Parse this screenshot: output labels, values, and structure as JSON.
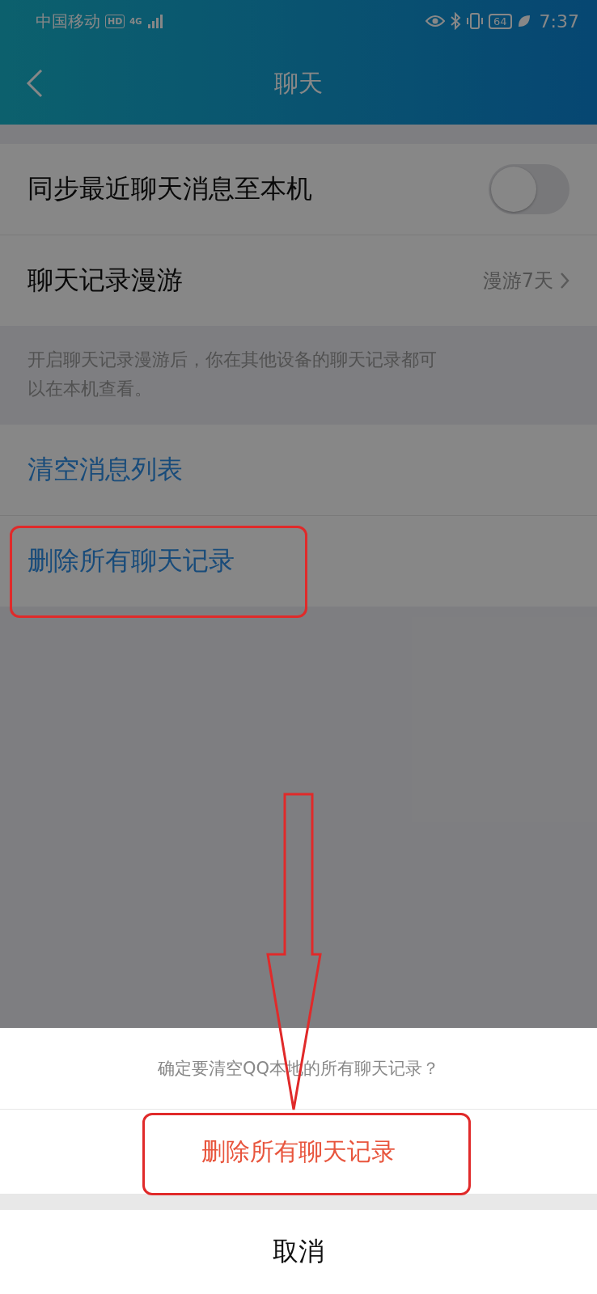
{
  "status_bar": {
    "carrier": "中国移动",
    "hd": "HD",
    "network": "4G",
    "battery": "64",
    "time": "7:37"
  },
  "header": {
    "title": "聊天"
  },
  "settings": [
    {
      "kind": "toggle",
      "label": "同步最近聊天消息至本机",
      "on": false
    },
    {
      "kind": "link",
      "label": "聊天记录漫游",
      "value": "漫游7天"
    }
  ],
  "hint": "开启聊天记录漫游后，你在其他设备的聊天记录都可以在本机查看。",
  "actions": [
    "清空消息列表",
    "删除所有聊天记录"
  ],
  "sheet": {
    "prompt": "确定要清空QQ本地的所有聊天记录？",
    "options": [
      {
        "kind": "destructive",
        "label": "删除所有聊天记录"
      }
    ],
    "cancel": "取消"
  }
}
